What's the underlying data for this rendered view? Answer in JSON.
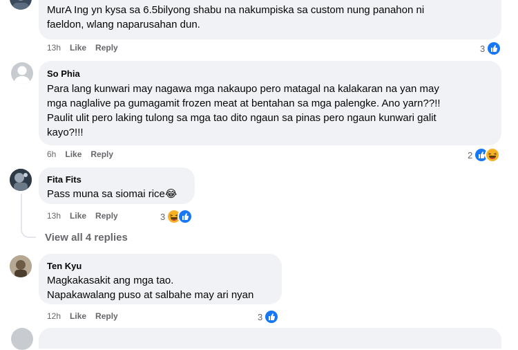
{
  "comments": [
    {
      "author": "",
      "text_lines": [
        "MurA Ing yn kysa sa 6.5bilyong shabu na nakumpiska sa custom nung panahon ni",
        "faeldon, wlang naparusahan dun."
      ],
      "time": "13h",
      "like": "Like",
      "reply": "Reply",
      "reactions_count": "3",
      "reactions": [
        "like-icon"
      ]
    },
    {
      "author": "So Phia",
      "text_lines": [
        "Para lang kunwari may nagawa mga nakaupo pero matagal na kalakaran na yan may",
        "mga naglalive pa gumagamit frozen meat at bentahan sa mga palengke. Ano yarn??!!",
        "Paulit ulit pero laking tulong sa mga tao dito ngaun sa pinas pero ngaun kunwari galit",
        "kayo?!!!"
      ],
      "time": "6h",
      "like": "Like",
      "reply": "Reply",
      "reactions_count": "2",
      "reactions": [
        "like-icon",
        "haha-icon"
      ]
    },
    {
      "author": "Fita Fits",
      "text_lines": [
        "Pass muna sa siomai rice"
      ],
      "emoji": "😂",
      "time": "13h",
      "like": "Like",
      "reply": "Reply",
      "reactions_count": "3",
      "reactions": [
        "haha-icon",
        "like-icon"
      ]
    },
    {
      "author": "Ten Kyu",
      "text_lines": [
        "Magkakasakit ang mga tao.",
        "Napakawalang puso at salbahe may ari nyan"
      ],
      "time": "12h",
      "like": "Like",
      "reply": "Reply",
      "reactions_count": "3",
      "reactions": [
        "like-icon"
      ]
    }
  ],
  "view_all_replies": "View all 4 replies",
  "colors": {
    "bubble": "#f0f2f5",
    "meta_text": "#65676b",
    "like_blue": "#1877f2",
    "haha_yellow": "#f7b125"
  }
}
